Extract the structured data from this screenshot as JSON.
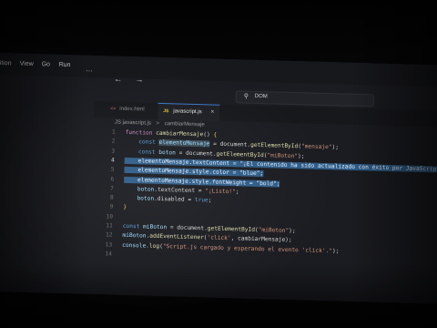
{
  "menubar": {
    "items": [
      "ition",
      "View",
      "Go",
      "Run",
      "···"
    ]
  },
  "nav": {
    "back": "←",
    "forward": "→"
  },
  "search": {
    "icon": "search-icon",
    "text": "DOM"
  },
  "tabs": [
    {
      "label": "index.html",
      "active": false
    },
    {
      "label": "javascript.js",
      "badge": "JS",
      "close": "×",
      "active": true
    }
  ],
  "breadcrumb": {
    "file": "JS javascript.js",
    "sep": ">",
    "symbol": "cambiarMensaje"
  },
  "editor": {
    "line_numbers": [
      "1",
      "2",
      "3",
      "4",
      "5",
      "6",
      "7",
      "8",
      "9",
      "10",
      "11",
      "12",
      "13",
      "14"
    ],
    "active_line": "4",
    "code": [
      [
        {
          "t": "function ",
          "c": "kw"
        },
        {
          "t": "cambiarMensaje",
          "c": "fn"
        },
        {
          "t": "() ",
          "c": ""
        },
        {
          "t": "{",
          "c": "brace"
        }
      ],
      [
        {
          "t": "    const ",
          "c": "decl"
        },
        {
          "t": "elementoMensaje",
          "c": "var hl"
        },
        {
          "t": " = document.",
          "c": ""
        },
        {
          "t": "getElementById",
          "c": "fn"
        },
        {
          "t": "(",
          "c": ""
        },
        {
          "t": "\"mensaje\"",
          "c": "str"
        },
        {
          "t": ");",
          "c": ""
        }
      ],
      [
        {
          "t": "    const ",
          "c": "decl"
        },
        {
          "t": "boton",
          "c": "var"
        },
        {
          "t": " = document.",
          "c": ""
        },
        {
          "t": "getElementById",
          "c": "fn"
        },
        {
          "t": "(",
          "c": ""
        },
        {
          "t": "\"miBoton\"",
          "c": "str"
        },
        {
          "t": ");",
          "c": ""
        }
      ],
      [
        {
          "t": "    elementoMensaje",
          "c": "sel"
        },
        {
          "t": ".textContent = ",
          "c": "sel"
        },
        {
          "t": "\"¡El contenido ha sido actualizado con éxito por JavaScript!\"",
          "c": "sel"
        },
        {
          "t": ";",
          "c": "sel"
        }
      ],
      [
        {
          "t": "    elementoMensaje",
          "c": "sel"
        },
        {
          "t": ".style.color = ",
          "c": "sel"
        },
        {
          "t": "\"blue\"",
          "c": "sel"
        },
        {
          "t": ";",
          "c": "sel"
        }
      ],
      [
        {
          "t": "    elementoMensaje",
          "c": "sel"
        },
        {
          "t": ".style.fontWeight = ",
          "c": "sel"
        },
        {
          "t": "\"bold\"",
          "c": "sel"
        },
        {
          "t": ";",
          "c": "sel"
        }
      ],
      [
        {
          "t": "    boton",
          "c": "var"
        },
        {
          "t": ".textContent = ",
          "c": ""
        },
        {
          "t": "\"¡Listo!\"",
          "c": "str"
        },
        {
          "t": ";",
          "c": ""
        }
      ],
      [
        {
          "t": "    boton",
          "c": "var"
        },
        {
          "t": ".disabled = ",
          "c": ""
        },
        {
          "t": "true",
          "c": "decl"
        },
        {
          "t": ";",
          "c": ""
        }
      ],
      [
        {
          "t": "}",
          "c": "brace"
        }
      ],
      [
        {
          "t": "",
          "c": ""
        }
      ],
      [
        {
          "t": "const ",
          "c": "decl"
        },
        {
          "t": "miBoton",
          "c": "var"
        },
        {
          "t": " = document.",
          "c": ""
        },
        {
          "t": "getElementById",
          "c": "fn"
        },
        {
          "t": "(",
          "c": ""
        },
        {
          "t": "\"miBoton\"",
          "c": "str"
        },
        {
          "t": ");",
          "c": ""
        }
      ],
      [
        {
          "t": "miBoton",
          "c": "var"
        },
        {
          "t": ".",
          "c": ""
        },
        {
          "t": "addEventListener",
          "c": "fn"
        },
        {
          "t": "(",
          "c": ""
        },
        {
          "t": "'click'",
          "c": "str"
        },
        {
          "t": ", cambiarMensaje);",
          "c": ""
        }
      ],
      [
        {
          "t": "console",
          "c": "var"
        },
        {
          "t": ".",
          "c": ""
        },
        {
          "t": "log",
          "c": "fn"
        },
        {
          "t": "(",
          "c": ""
        },
        {
          "t": "\"Script.js cargado y esperando el evento 'click'.\"",
          "c": "str"
        },
        {
          "t": ");",
          "c": ""
        }
      ],
      [
        {
          "t": "",
          "c": ""
        }
      ]
    ]
  }
}
